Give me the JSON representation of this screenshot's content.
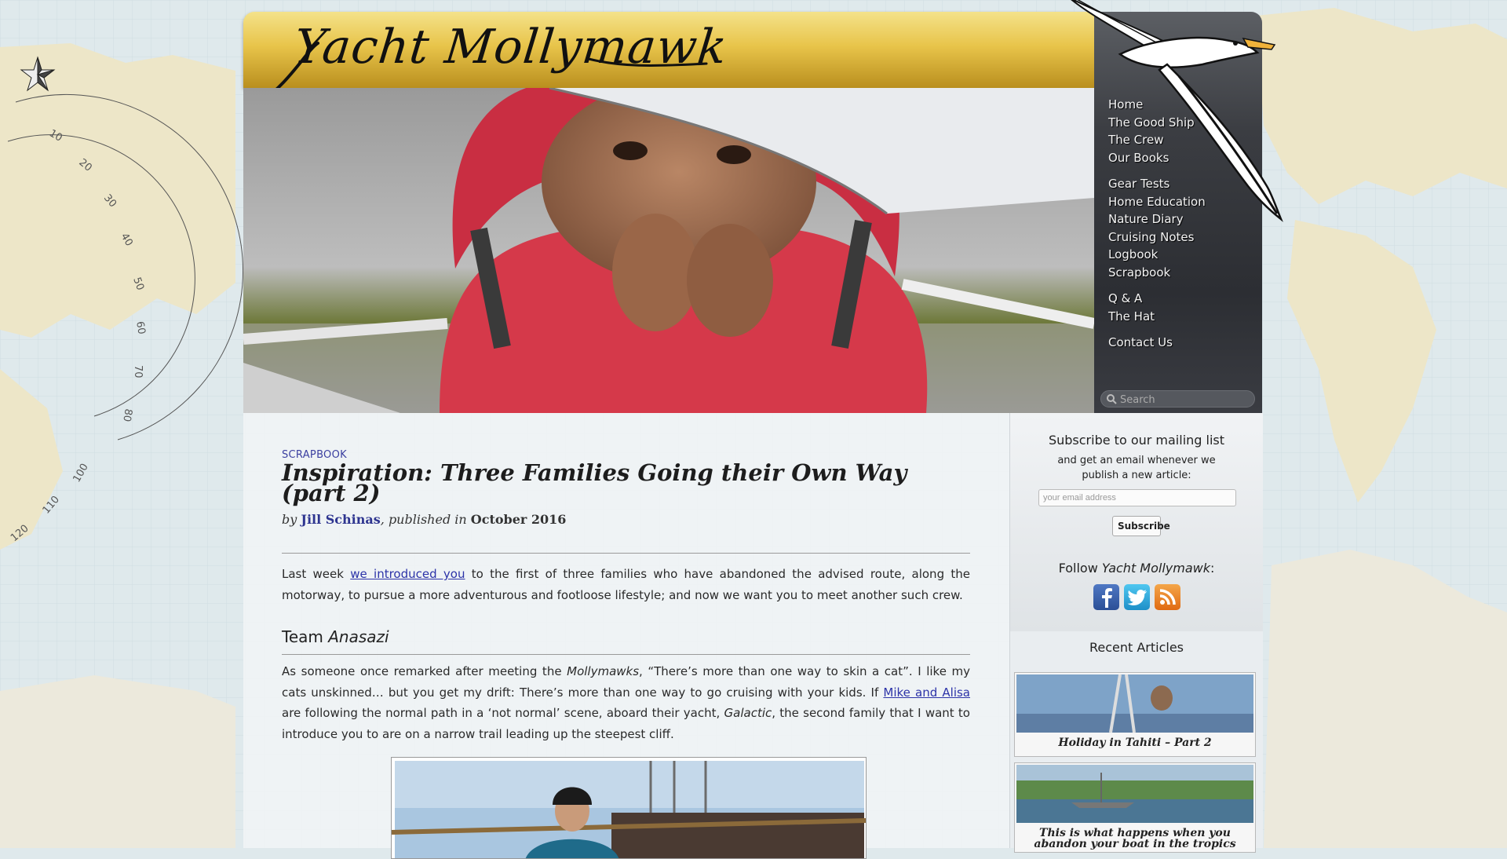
{
  "site": {
    "title": "Yacht Mollymawk"
  },
  "nav": {
    "groups": [
      [
        "Home",
        "The Good Ship",
        "The Crew",
        "Our Books"
      ],
      [
        "Gear Tests",
        "Home Education",
        "Nature Diary",
        "Cruising Notes",
        "Logbook",
        "Scrapbook"
      ],
      [
        "Q & A",
        "The Hat"
      ],
      [
        "Contact Us"
      ]
    ],
    "search_placeholder": "Search"
  },
  "post": {
    "category": "SCRAPBOOK",
    "title": "Inspiration: Three Families Going their Own Way (part 2)",
    "byline_by": "by",
    "author": "Jill Schinas",
    "byline_mid": ", published in",
    "date": "October 2016",
    "intro_before_link": "Last week ",
    "intro_link": "we introduced you",
    "intro_after_link": " to the first of three families who have abandoned the advised route, along the motorway, to pursue a more adventurous and footloose lifestyle; and now we want you to meet another such crew.",
    "section_prefix": "Team ",
    "section_name": "Anasazi",
    "p2_a": "As someone once remarked after meeting the ",
    "p2_em1": "Mollymawks",
    "p2_b": ", “There’s more than one way to skin a cat”. I like my cats unskinned… but you get my drift: There’s more than one way to go cruising with your kids. If ",
    "p2_link": "Mike and Alisa",
    "p2_c": " are following the normal path in a ‘not normal’ scene, aboard their yacht, ",
    "p2_em2": "Galactic",
    "p2_d": ", the second family that I want to introduce you to are on a narrow trail leading up the steepest cliff."
  },
  "subscribe": {
    "title": "Subscribe to our mailing list",
    "description": "and get an email whenever we publish a new article:",
    "email_placeholder": "your email address",
    "button_label": "Subscribe",
    "follow_prefix": "Follow ",
    "follow_name": "Yacht Mollymawk",
    "follow_suffix": ":"
  },
  "social": [
    "facebook-icon",
    "twitter-icon",
    "rss-icon"
  ],
  "recent": {
    "title": "Recent Articles",
    "items": [
      "Holiday in Tahiti – Part 2",
      "This is what happens when you abandon your boat in the tropics"
    ]
  },
  "colors": {
    "header_gold": "#e8c44a",
    "nav_dark": "#2c2e33",
    "link_blue": "#2c33a8",
    "map_sea": "#dfe9ec",
    "map_land": "#ede6c8"
  }
}
